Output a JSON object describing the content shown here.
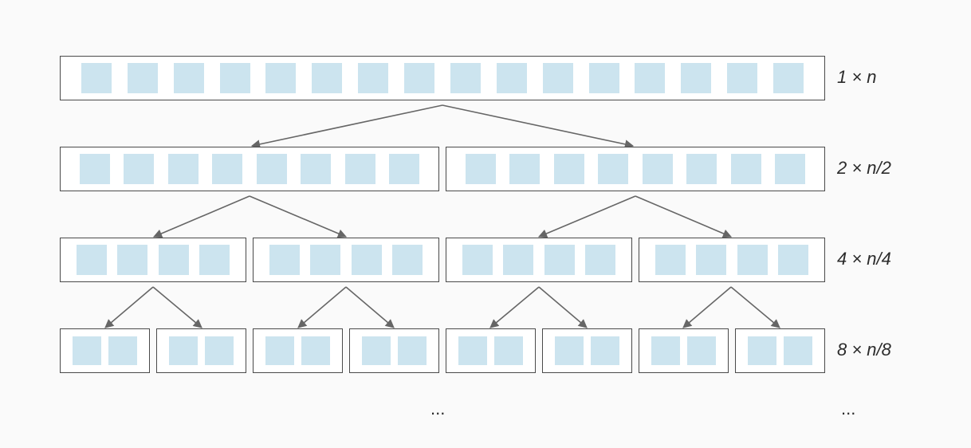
{
  "diagram": {
    "levels": [
      {
        "groups": 1,
        "cells_per_group": 16,
        "label": "1 × n"
      },
      {
        "groups": 2,
        "cells_per_group": 8,
        "label": "2 × n/2"
      },
      {
        "groups": 4,
        "cells_per_group": 4,
        "label": "4 × n/4"
      },
      {
        "groups": 8,
        "cells_per_group": 2,
        "label": "8 × n/8"
      }
    ],
    "ellipsis": "...",
    "arrow_color": "#666666",
    "cell_color": "#cce4ef",
    "border_color": "#4a4a4a"
  }
}
